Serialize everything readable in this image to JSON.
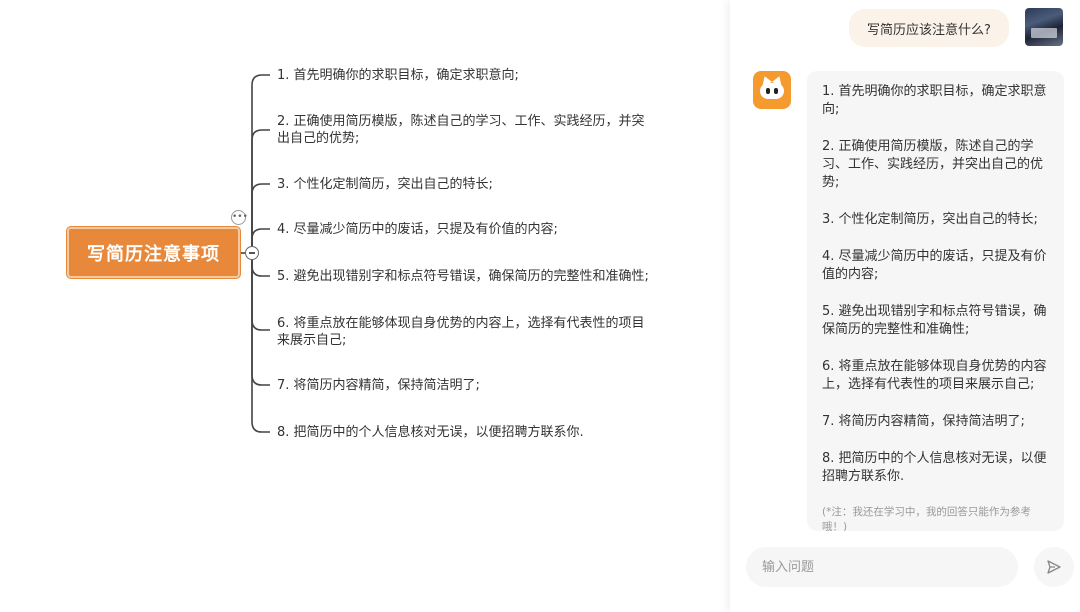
{
  "mindmap": {
    "root": "写简历注意事项",
    "branches": [
      "1. 首先明确你的求职目标，确定求职意向;",
      "2. 正确使用简历模版，陈述自己的学习、工作、实践经历，并突出自己的优势;",
      "3. 个性化定制简历，突出自己的特长;",
      "4. 尽量减少简历中的废话，只提及有价值的内容;",
      "5. 避免出现错别字和标点符号错误，确保简历的完整性和准确性;",
      "6. 将重点放在能够体现自身优势的内容上，选择有代表性的项目来展示自己;",
      "7. 将简历内容精简，保持简洁明了;",
      "8. 把简历中的个人信息核对无误，以便招聘方联系你."
    ],
    "more_icon": "ellipsis-icon",
    "collapse_icon": "minus-circle-icon",
    "accent_color": "#e8883a"
  },
  "chat": {
    "user_question": "写简历应该注意什么?",
    "answer": [
      "1. 首先明确你的求职目标，确定求职意向;",
      "2. 正确使用简历模版，陈述自己的学习、工作、实践经历，并突出自己的优势;",
      "3. 个性化定制简历，突出自己的特长;",
      "4. 尽量减少简历中的废话，只提及有价值的内容;",
      "5. 避免出现错别字和标点符号错误，确保简历的完整性和准确性;",
      "6. 将重点放在能够体现自身优势的内容上，选择有代表性的项目来展示自己;",
      "7. 将简历内容精简，保持简洁明了;",
      "8. 把简历中的个人信息核对无误，以便招聘方联系你."
    ],
    "note": "(*注：我还在学习中，我的回答只能作为参考哦！)",
    "input_placeholder": "输入问题",
    "send_icon": "send-icon",
    "bot_color": "#f49a2f"
  }
}
